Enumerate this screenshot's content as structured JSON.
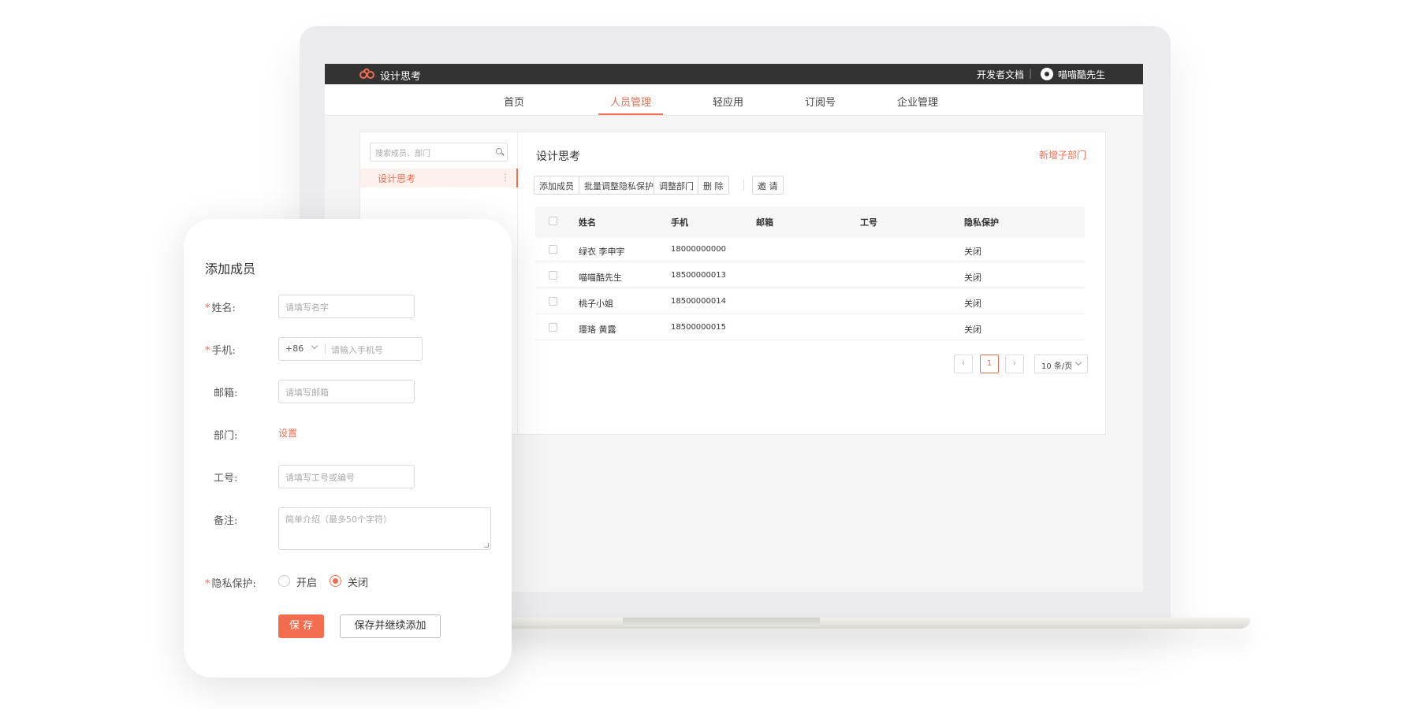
{
  "app": {
    "brand": "设计思考",
    "dev_docs": "开发者文档",
    "separator": "|",
    "username": "喵喵酷先生"
  },
  "nav": {
    "items": [
      "首页",
      "人员管理",
      "轻应用",
      "订阅号",
      "企业管理"
    ],
    "active": "人员管理"
  },
  "sidebar": {
    "search_placeholder": "搜索成员、部门",
    "tree_items": [
      {
        "label": "设计思考",
        "selected": true
      }
    ],
    "more_glyph": "⋮"
  },
  "main": {
    "dept_title": "设计思考",
    "add_sub_dept": "新增子部门",
    "toolbar": [
      "添加成员",
      "批量调整隐私保护",
      "调整部门",
      "删 除",
      "邀 请"
    ],
    "columns": [
      "姓名",
      "手机",
      "邮箱",
      "工号",
      "隐私保护"
    ],
    "rows": [
      {
        "name": "绿衣 李申宇",
        "phone": "18000000000",
        "email": "",
        "id": "",
        "privacy": "关闭"
      },
      {
        "name": "喵喵酷先生",
        "phone": "18500000013",
        "email": "",
        "id": "",
        "privacy": "关闭"
      },
      {
        "name": "桃子小姐",
        "phone": "18500000014",
        "email": "",
        "id": "",
        "privacy": "关闭"
      },
      {
        "name": "璎珞 黄露",
        "phone": "18500000015",
        "email": "",
        "id": "",
        "privacy": "关闭"
      }
    ],
    "pagination": {
      "prev": "‹",
      "current_page": "1",
      "next": "›",
      "page_size": "10 条/页"
    }
  },
  "form": {
    "title": "添加成员",
    "required_mark": "*",
    "name_label": "姓名:",
    "name_placeholder": "请填写名字",
    "phone_label": "手机:",
    "country_code": "+86",
    "phone_placeholder": "请输入手机号",
    "email_label": "邮箱:",
    "email_placeholder": "请填写邮箱",
    "dept_label": "部门:",
    "dept_link": "设置",
    "empid_label": "工号:",
    "empid_placeholder": "请填写工号或编号",
    "note_label": "备注:",
    "note_placeholder": "简单介绍（最多50个字符）",
    "privacy_label": "隐私保护:",
    "privacy_on": "开启",
    "privacy_off": "关闭",
    "privacy_selected": "关闭",
    "save": "保 存",
    "save_continue": "保存并继续添加"
  },
  "colors": {
    "accent": "#f26d4f",
    "topbar": "#333333"
  }
}
